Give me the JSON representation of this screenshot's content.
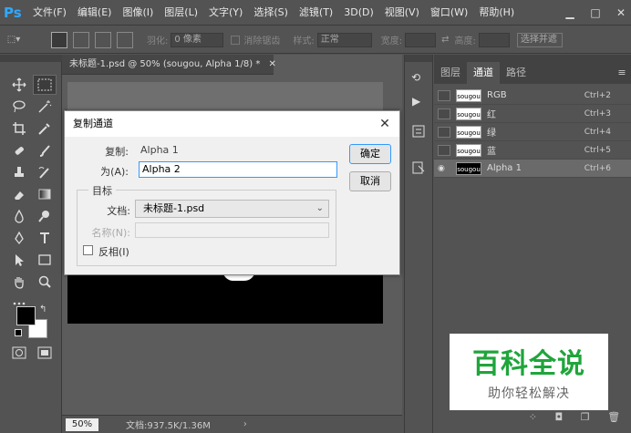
{
  "app": {
    "logo": "Ps"
  },
  "menu": [
    "文件(F)",
    "编辑(E)",
    "图像(I)",
    "图层(L)",
    "文字(Y)",
    "选择(S)",
    "滤镜(T)",
    "3D(D)",
    "视图(V)",
    "窗口(W)",
    "帮助(H)"
  ],
  "options": {
    "feather_label": "羽化:",
    "feather_value": "0 像素",
    "antialias_label": "消除锯齿",
    "style_label": "样式:",
    "style_value": "正常",
    "width_label": "宽度:",
    "height_label": "高度:",
    "select_btn": "选择并遮"
  },
  "document": {
    "tab_title": "未标题-1.psd @ 50% (sougou, Alpha 1/8) *",
    "zoom": "50%",
    "doc_info": "文档:937.5K/1.36M"
  },
  "panels": {
    "tabs": [
      "图层",
      "通道",
      "路径"
    ],
    "channels": [
      {
        "name": "RGB",
        "shortcut": "Ctrl+2",
        "thumb": "sougou",
        "selected": false,
        "visible": false
      },
      {
        "name": "红",
        "shortcut": "Ctrl+3",
        "thumb": "sougou",
        "selected": false,
        "visible": false
      },
      {
        "name": "绿",
        "shortcut": "Ctrl+4",
        "thumb": "sougou",
        "selected": false,
        "visible": false
      },
      {
        "name": "蓝",
        "shortcut": "Ctrl+5",
        "thumb": "sougou",
        "selected": false,
        "visible": false
      },
      {
        "name": "Alpha 1",
        "shortcut": "Ctrl+6",
        "thumb": "sougou",
        "selected": true,
        "visible": true
      }
    ]
  },
  "dialog": {
    "title": "复制通道",
    "copy_label": "复制:",
    "copy_value": "Alpha 1",
    "as_label": "为(A):",
    "as_value": "Alpha 2",
    "ok": "确定",
    "cancel": "取消",
    "target_group": "目标",
    "doc_label": "文档:",
    "doc_value": "未标题-1.psd",
    "name_label": "名称(N):",
    "invert_label": "反相(I)"
  },
  "watermark": {
    "big": "百科全说",
    "small": "助你轻松解决"
  },
  "colors": {
    "accent": "#31a8ff",
    "selection": "#3399ff",
    "watermark_green": "#1fa53b"
  }
}
